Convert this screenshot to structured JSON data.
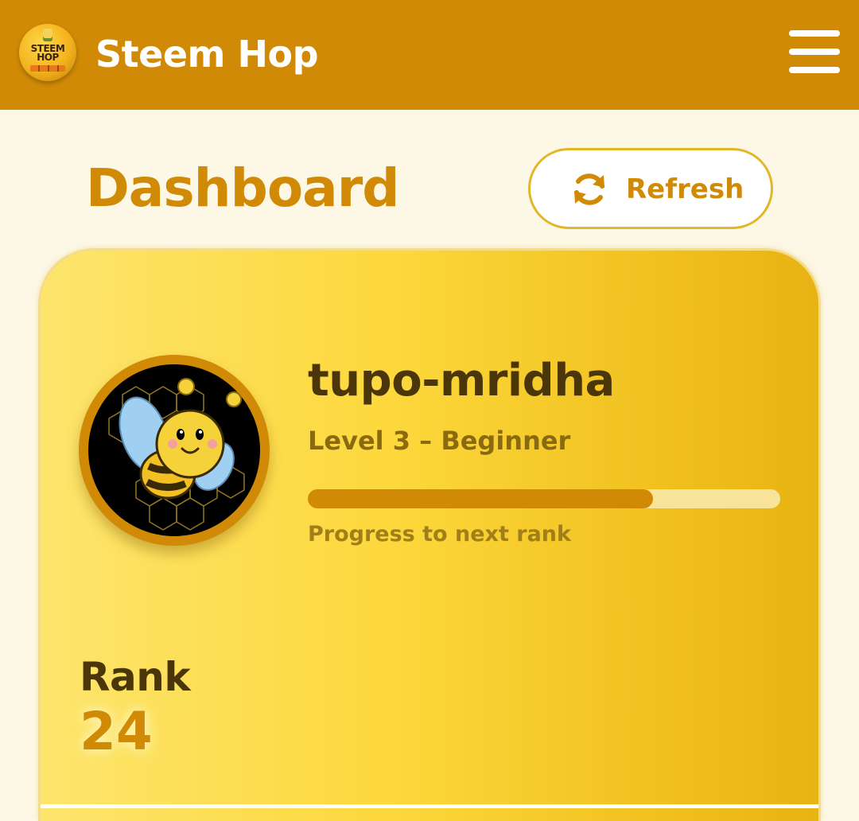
{
  "header": {
    "app_title": "Steem Hop",
    "logo_text_line1": "STEEM",
    "logo_text_line2": "HOP",
    "menu_icon": "hamburger-menu-icon"
  },
  "dashboard": {
    "title": "Dashboard",
    "refresh_label": "Refresh",
    "refresh_icon": "refresh-icon"
  },
  "profile": {
    "username": "tupo-mridha",
    "level_text": "Level 3 – Beginner",
    "progress_fraction": 0.73,
    "progress_label": "Progress to next rank",
    "rank_label": "Rank",
    "rank_value": "24"
  },
  "colors": {
    "header_bg": "#d08a06",
    "accent": "#d08a06",
    "page_bg": "#fdf8e6",
    "card_gradient_start": "#fde56d",
    "card_gradient_end": "#e8b314",
    "text_dark": "#4a3608"
  }
}
